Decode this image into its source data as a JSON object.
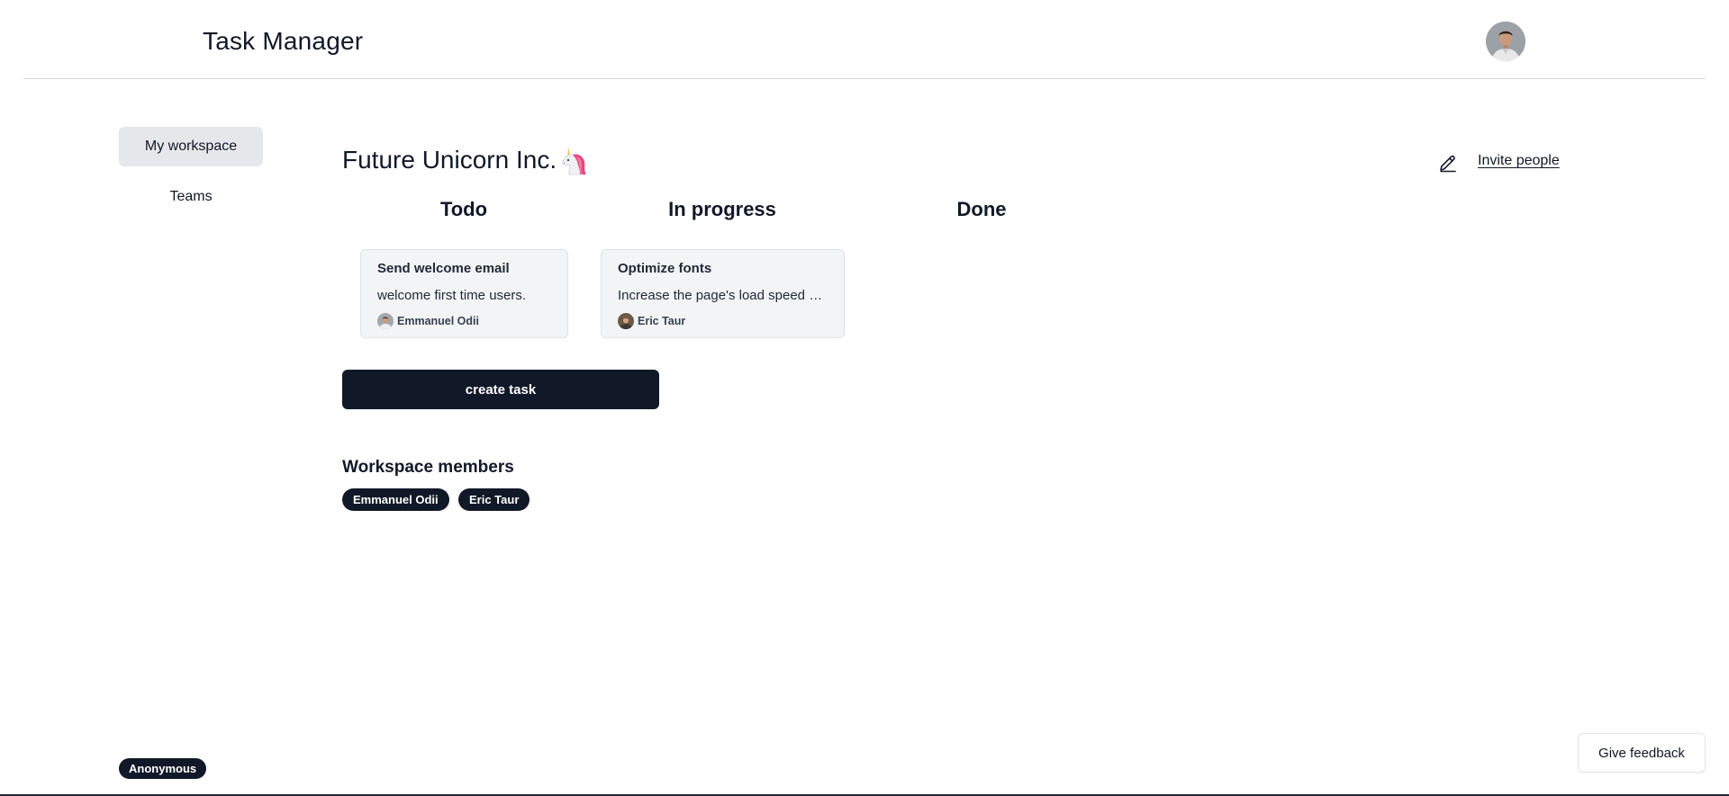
{
  "header": {
    "app_title": "Task Manager",
    "avatar_icon": "user-avatar-photo"
  },
  "sidebar": {
    "items": [
      {
        "label": "My workspace",
        "active": true
      },
      {
        "label": "Teams",
        "active": false
      }
    ]
  },
  "workspace": {
    "name": "Future Unicorn Inc.",
    "emoji_icon": "unicorn-icon",
    "edit_icon": "pencil-icon",
    "invite_label": "Invite people"
  },
  "board": {
    "columns": [
      {
        "title": "Todo"
      },
      {
        "title": "In progress"
      },
      {
        "title": "Done"
      }
    ],
    "cards": [
      {
        "column": "Todo",
        "title": "Send welcome email",
        "description": "welcome first time users.",
        "assignee": "Emmanuel Odii"
      },
      {
        "column": "In progress",
        "title": "Optimize fonts",
        "description": "Increase the page's load speed b...",
        "assignee": "Eric Taur"
      }
    ]
  },
  "actions": {
    "create_task_label": "create task"
  },
  "members": {
    "title": "Workspace members",
    "list": [
      "Emmanuel Odii",
      "Eric Taur"
    ]
  },
  "footer": {
    "user_badge": "Anonymous",
    "feedback_label": "Give feedback"
  },
  "colors": {
    "primary_dark": "#111827",
    "card_bg": "#f3f4f6",
    "active_nav_bg": "#e6e7ea",
    "divider": "#d9dce1"
  }
}
